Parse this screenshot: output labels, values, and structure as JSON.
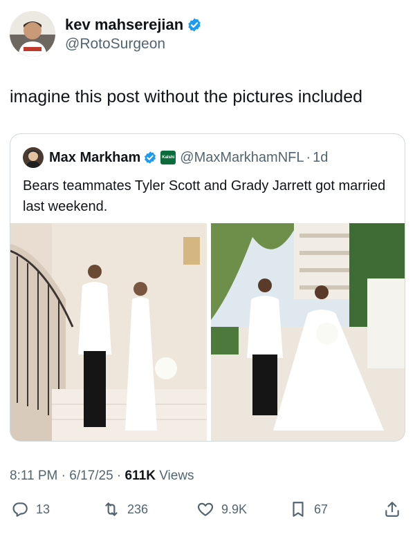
{
  "author": {
    "display_name": "kev mahserejian",
    "handle": "@RotoSurgeon",
    "avatar_icon": "user-avatar"
  },
  "tweet": {
    "text": "imagine this post without the pictures included"
  },
  "quote": {
    "display_name": "Max Markham",
    "affiliate_label": "Kalshi",
    "handle": "@MaxMarkhamNFL",
    "separator": "·",
    "time": "1d",
    "text": "Bears teammates Tyler Scott and Grady Jarrett got married last weekend."
  },
  "meta": {
    "time": "8:11 PM",
    "dot1": " · ",
    "date": "6/17/25",
    "dot2": " · ",
    "views_count": "611K",
    "views_label": " Views"
  },
  "actions": {
    "replies": "13",
    "reposts": "236",
    "likes": "9.9K",
    "bookmarks": "67"
  },
  "colors": {
    "verified": "#1d9bf0",
    "muted": "#536471",
    "text": "#0f1419",
    "border": "#cfd9de"
  }
}
